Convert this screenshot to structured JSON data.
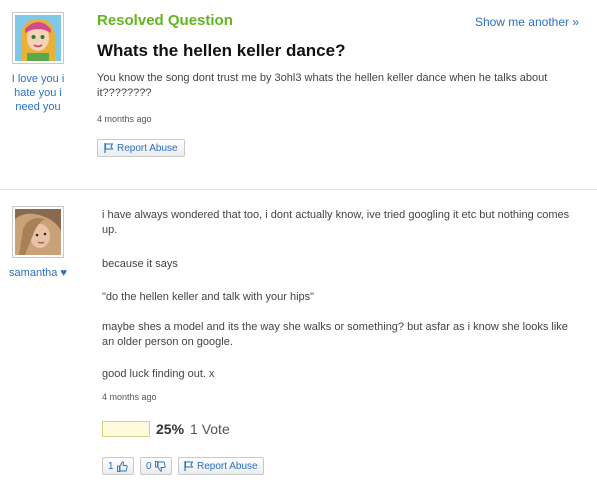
{
  "question": {
    "status": "Resolved Question",
    "show_another": "Show me another »",
    "title": "Whats the hellen keller dance?",
    "body": "You know the song dont trust me by 3ohl3 whats the hellen keller dance when he talks about it????????",
    "time": "4 months ago",
    "report_label": "Report Abuse",
    "asker": {
      "name_line1": "I love you i",
      "name_line2": "hate you i",
      "name_line3": "need you",
      "avatar_icon": "cartoon-avatar-icon"
    }
  },
  "answer": {
    "author": "samantha ♥",
    "avatar_icon": "user-photo-icon",
    "paragraphs": [
      "i have always wondered that too, i dont actually know, ive tried googling it etc but nothing comes up.",
      "because it says",
      "\"do the hellen keller and talk with your hips\"",
      "maybe shes a model and its the way she walks or something? but asfar as i know she looks like an older person on google.",
      "good luck finding out. x"
    ],
    "time": "4 months ago",
    "vote_percent": "25%",
    "vote_fraction": 0.25,
    "vote_count": "1 Vote",
    "thumbs_up_count": "1",
    "thumbs_down_count": "0",
    "report_label": "Report Abuse"
  },
  "colors": {
    "accent_green": "#63b520",
    "link_blue": "#2a6fc4",
    "vote_bar": "#fdfbdc"
  }
}
